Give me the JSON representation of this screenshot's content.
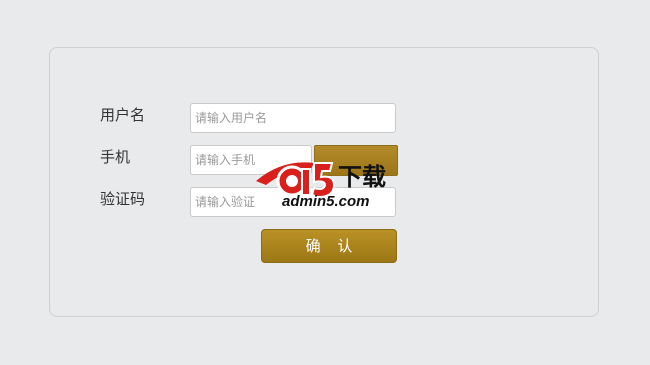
{
  "form": {
    "username_label": "用户名",
    "username_placeholder": "请输入用户名",
    "phone_label": "手机",
    "phone_placeholder": "请输入手机",
    "code_label": "验证码",
    "code_placeholder": "请输入验证",
    "send_code_label": "",
    "confirm_label": "确 认"
  },
  "watermark": {
    "logo_text": "admin5.com",
    "brand": "a5下载"
  },
  "colors": {
    "background": "#e9eaec",
    "button_gold": "#a88220",
    "watermark_red": "#d9201c"
  }
}
